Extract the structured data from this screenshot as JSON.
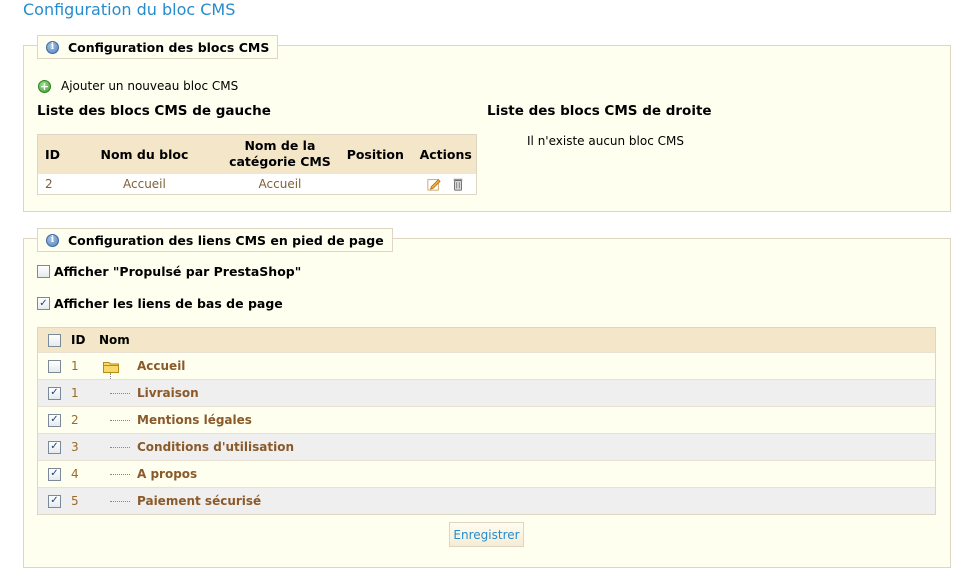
{
  "page_title": "Configuration du bloc CMS",
  "blocks_section": {
    "legend": "Configuration des blocs CMS",
    "add_label": "Ajouter un nouveau bloc CMS",
    "left_title": "Liste des blocs CMS de gauche",
    "right_title": "Liste des blocs CMS de droite",
    "right_empty": "Il n'existe aucun bloc CMS",
    "columns": [
      "ID",
      "Nom du bloc",
      "Nom de la catégorie CMS",
      "Position",
      "Actions"
    ],
    "rows": [
      {
        "id": "2",
        "name": "Accueil",
        "category": "Accueil",
        "position": ""
      }
    ]
  },
  "footer_section": {
    "legend": "Configuration des liens CMS en pied de page",
    "option_powered": {
      "label": "Afficher \"Propulsé par PrestaShop\"",
      "checked": false
    },
    "option_links": {
      "label": "Afficher les liens de bas de page",
      "checked": true
    },
    "columns": {
      "id": "ID",
      "name": "Nom"
    },
    "rows": [
      {
        "id": "1",
        "name": "Accueil",
        "checked": false,
        "folder": true
      },
      {
        "id": "1",
        "name": "Livraison",
        "checked": true
      },
      {
        "id": "2",
        "name": "Mentions légales",
        "checked": true
      },
      {
        "id": "3",
        "name": "Conditions d'utilisation",
        "checked": true
      },
      {
        "id": "4",
        "name": "A propos",
        "checked": true
      },
      {
        "id": "5",
        "name": "Paiement sécurisé",
        "checked": true
      }
    ],
    "save_label": "Enregistrer"
  },
  "colors": {
    "accent": "#268ccd",
    "header_bg": "#f4e6c9",
    "panel_bg": "#fffff0",
    "link": "#8a5a2a"
  },
  "icons": {
    "info": "info-icon",
    "add": "plus-circle-icon",
    "edit": "pencil-icon",
    "delete": "trash-icon",
    "folder": "folder-icon"
  }
}
